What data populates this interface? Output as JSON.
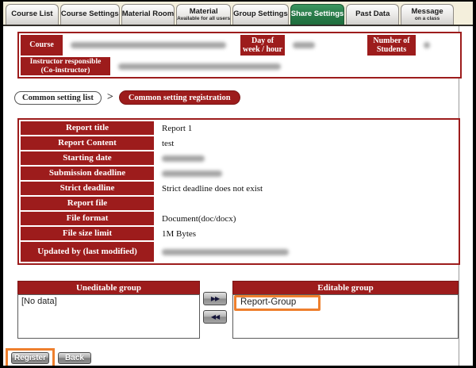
{
  "tabs": [
    {
      "label": "Course List"
    },
    {
      "label": "Course Settings"
    },
    {
      "label": "Material Room"
    },
    {
      "label": "Material",
      "sublabel": "Available for all users"
    },
    {
      "label": "Group Settings"
    },
    {
      "label": "Share Settings",
      "active": true
    },
    {
      "label": "Past Data"
    },
    {
      "label": "Message",
      "sublabel": "on a class"
    }
  ],
  "course_header": {
    "course_label": "Course",
    "day_of_week_label": "Day of week / hour",
    "students_label": "Number of Students",
    "instructor_label": "Instructor responsible (Co-instructor)"
  },
  "breadcrumb": {
    "list_button_label": "Common setting list",
    "separator": ">",
    "current_label": "Common setting registration"
  },
  "form": {
    "rows": [
      {
        "label": "Report title",
        "value": "Report 1"
      },
      {
        "label": "Report Content",
        "value": "test"
      },
      {
        "label": "Starting date",
        "value": "",
        "redacted": true
      },
      {
        "label": "Submission deadline",
        "value": "",
        "redacted": true
      },
      {
        "label": "Strict deadline",
        "value": "Strict deadline does not exist"
      },
      {
        "label": "Report file",
        "value": ""
      },
      {
        "label": "File format",
        "value": "Document(doc/docx)"
      },
      {
        "label": "File size limit",
        "value": "1M Bytes"
      },
      {
        "label": "Updated by (last modified)",
        "value": "",
        "redacted": true
      }
    ]
  },
  "groups": {
    "uneditable": {
      "title": "Uneditable group",
      "items": [
        "[No data]"
      ]
    },
    "editable": {
      "title": "Editable group",
      "items": [
        "Report-Group"
      ]
    },
    "move_right_label": "▶▶",
    "move_left_label": "◀◀"
  },
  "actions": {
    "register_label": "Register",
    "back_label": "Back"
  },
  "colors": {
    "accent_red": "#9d1c1c",
    "active_tab_green": "#2e7d49",
    "highlight_orange": "#ee7f2d",
    "tab_strip_cream": "#f4efdc"
  }
}
